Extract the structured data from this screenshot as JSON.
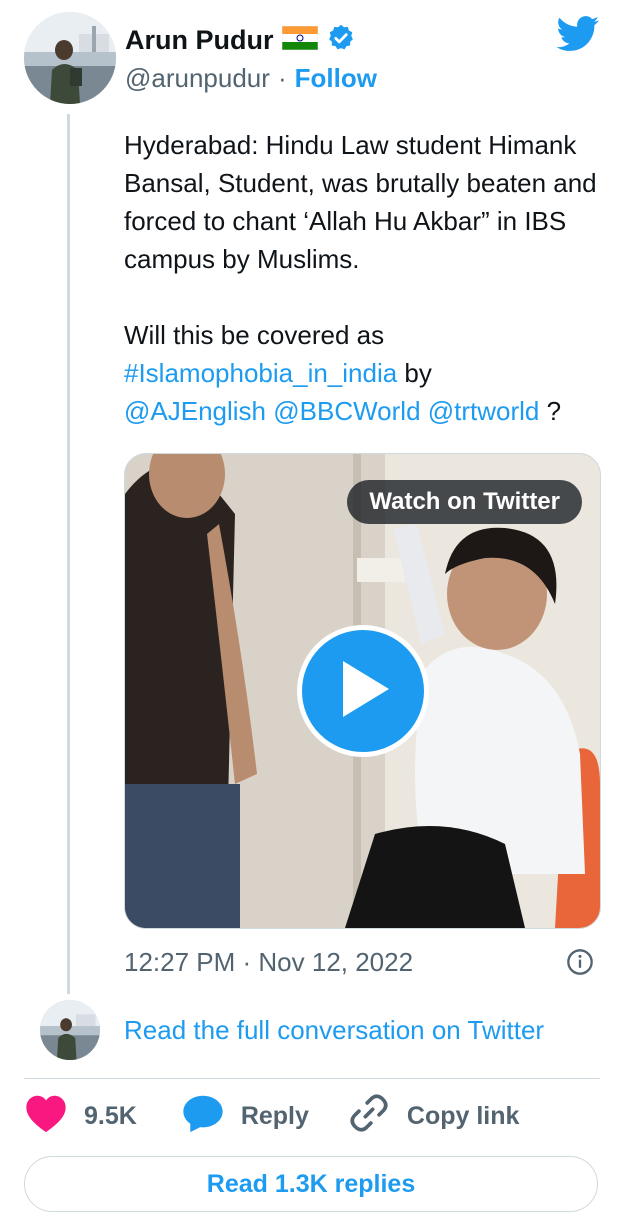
{
  "author": {
    "name": "Arun Pudur",
    "handle": "@arunpudur",
    "separator": "·",
    "follow_label": "Follow",
    "flag_icon": "india-flag-icon",
    "verified_icon": "verified-badge-icon",
    "brand_color": "#1d9bf0"
  },
  "tweet": {
    "paragraph1": "Hyderabad: Hindu Law student Himank Bansal, Student, was brutally beaten and forced to chant ‘Allah Hu Akbar” in IBS campus by Muslims.",
    "paragraph2_prefix": "Will this be covered as ",
    "hashtag": "#Islamophobia_in_india",
    "word_by": " by",
    "mention1": "@AJEnglish",
    "mention2": "@BBCWorld",
    "mention3": "@trtworld",
    "question_mark": " ?"
  },
  "media": {
    "watch_label": "Watch on Twitter",
    "play_icon": "play-icon"
  },
  "meta": {
    "timestamp": "12:27 PM · Nov 12, 2022",
    "info_icon": "info-icon"
  },
  "conversation": {
    "label": "Read the full conversation on Twitter"
  },
  "actions": {
    "likes_count": "9.5K",
    "reply_label": "Reply",
    "copy_link_label": "Copy link",
    "heart_color": "#f91880"
  },
  "replies_button": {
    "label": "Read 1.3K replies"
  }
}
